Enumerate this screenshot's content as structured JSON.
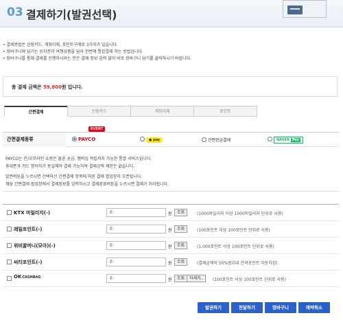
{
  "header": {
    "step": "03",
    "title": "결제하기(발권선택)"
  },
  "notes": [
    "결제방법은 신용카드, 계좌이체, 포인트구매로 3가지가 있습니다.",
    "장바구니에 담기는 승차권과 여행상품을 담아 한번에 통합결제 하는 방법입니다.",
    "장바구니를 통해 결제를 진행하시려는 분은 결제 정보 입력 없이 바로 장바구니 담기를 클릭하시기 바랍니다."
  ],
  "total": {
    "prefix": "총 결제 금액은 ",
    "amount": "59,800",
    "suffix": "원 입니다."
  },
  "tabs": [
    "간편결제",
    "신용카드",
    "계좌이체",
    "포인트"
  ],
  "methods": {
    "label": "간편결제종류",
    "event": "EVENT",
    "payco": "PAYCO",
    "kakao": "pay",
    "cash": "간편현금결제",
    "naver": "NAVER",
    "naver_pay": "Pay"
  },
  "info": [
    "PAYCO는 온/오프라인 쇼핑은 물론 송금, 멤버십 적립까지 가능한 통합 서비스입니다.",
    "휴대폰과 카드 명의자가 동일해야 결제 가능하며 결제금액 제한은 없습니다.",
    "발권버튼을 누르시면 선택하신 간편결제 항목에 따른 결제 팝업창이 오픈됩니다.",
    "해당 간편결제 팝업창에서 결제정보를 입력하시고 결제완료버튼을 누르시면 결제가 처리됩니다."
  ],
  "points": [
    {
      "name": "KTX 마일리지(-)",
      "value": "0",
      "unit": "원",
      "btn": "조회",
      "note": "(1000마일리지 이상 1000마일리지 단위로 사용)"
    },
    {
      "name": "레일포인트(-)",
      "value": "0",
      "unit": "원",
      "btn": "조회",
      "note": "(100포인트 이상 100포인트 단위로 사용)"
    },
    {
      "name": "위비꿀머니(모아)(-)",
      "value": "0",
      "unit": "원",
      "btn": "조회",
      "note": "(1,000포인트 이상 100포인트 단위로 사용)"
    },
    {
      "name": "씨티포인트(-)",
      "value": "0",
      "unit": "원",
      "btn": "조회",
      "note": "(결제금액의 50%범위내 잔여포인트 자동차감)"
    },
    {
      "name": "OK",
      "name_sub": "CASHBAG",
      "value": "0",
      "unit": "원",
      "btn": "조회",
      "btn2": "자세히..",
      "note": "(100포인트 이상 100포인트 단위로 사용)"
    }
  ],
  "actions": [
    "발권하기",
    "전달하기",
    "장바구니",
    "예약취소"
  ],
  "colors": {
    "accent": "#2b61c8",
    "payco": "#e60012",
    "naver": "#03c75a",
    "amount": "#d93025"
  }
}
